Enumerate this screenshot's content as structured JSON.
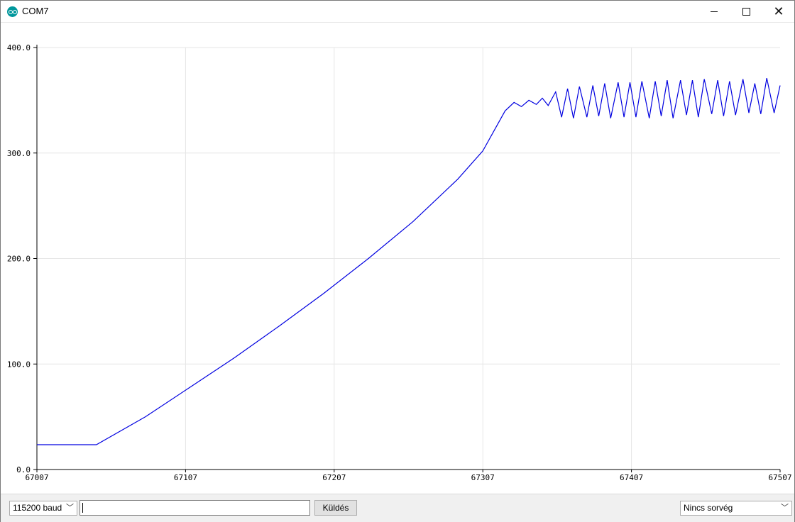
{
  "window": {
    "title": "COM7",
    "minimize_icon": "minimize-icon",
    "maximize_icon": "maximize-icon",
    "close_icon": "close-icon"
  },
  "plot": {
    "x_ticks": [
      "67007",
      "67107",
      "67207",
      "67307",
      "67407",
      "67507"
    ],
    "y_ticks": [
      "0.0",
      "100.0",
      "200.0",
      "300.0",
      "400.0"
    ],
    "line_color": "#0000e0",
    "grid_color": "#e6e6e6"
  },
  "chart_data": {
    "type": "line",
    "xlim": [
      67007,
      67507
    ],
    "ylim": [
      0,
      400
    ],
    "grid": true,
    "series": [
      {
        "x": [
          67007,
          67047,
          67080,
          67110,
          67140,
          67170,
          67200,
          67230,
          67260,
          67290,
          67307,
          67322,
          67328,
          67333,
          67338,
          67343,
          67347,
          67351,
          67356,
          67360,
          67364,
          67368,
          67372,
          67377,
          67381,
          67385,
          67389,
          67393,
          67398,
          67402,
          67406,
          67410,
          67414,
          67419,
          67423,
          67427,
          67431,
          67435,
          67440,
          67444,
          67448,
          67452,
          67456,
          67461,
          67465,
          67469,
          67473,
          67477,
          67482,
          67486,
          67490,
          67494,
          67498,
          67503,
          67507
        ],
        "y": [
          23.5,
          23.5,
          50,
          78,
          106,
          136,
          167,
          200,
          235,
          275,
          302,
          340,
          348,
          344,
          350,
          346,
          352,
          345,
          358,
          334,
          361,
          333,
          363,
          334,
          364,
          335,
          366,
          333,
          367,
          334,
          367,
          334,
          368,
          333,
          368,
          335,
          369,
          333,
          369,
          336,
          369,
          334,
          370,
          337,
          369,
          335,
          368,
          336,
          370,
          338,
          366,
          337,
          371,
          338,
          364
        ]
      }
    ]
  },
  "controls": {
    "baud_selected": "115200 baud",
    "message_input_value": "",
    "send_label": "Küldés",
    "line_ending_selected": "Nincs sorvég",
    "dropdown_icon": "chevron-down-icon"
  }
}
